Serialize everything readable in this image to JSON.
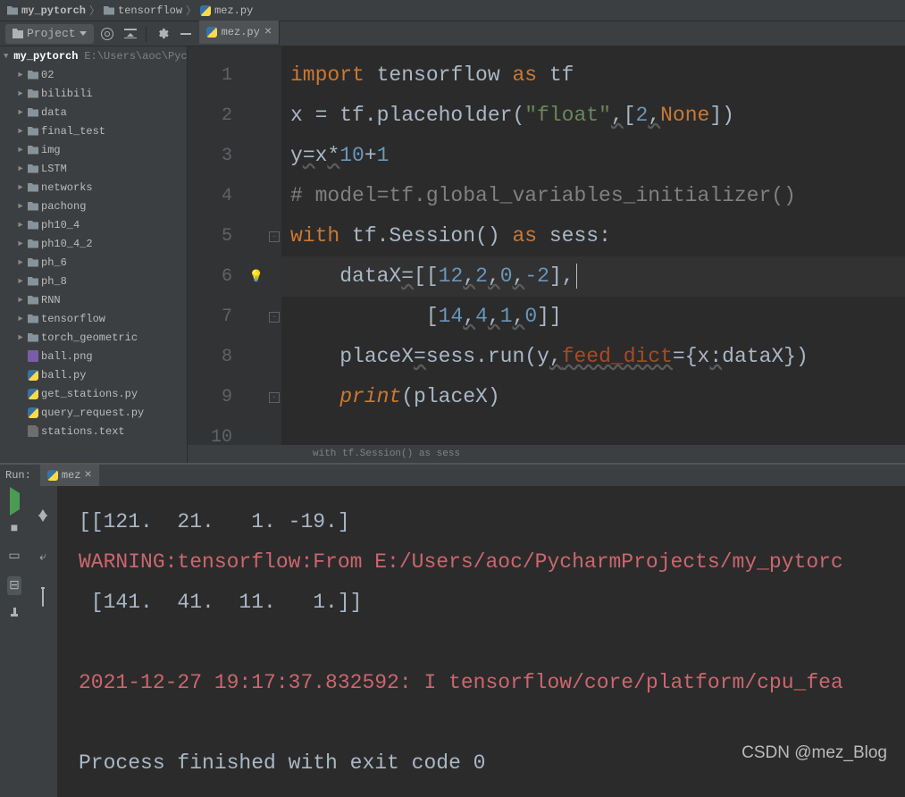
{
  "breadcrumb": [
    {
      "type": "folder",
      "label": "my_pytorch"
    },
    {
      "type": "folder",
      "label": "tensorflow"
    },
    {
      "type": "py",
      "label": "mez.py"
    }
  ],
  "projectBtn": "Project",
  "editorTab": {
    "label": "mez.py"
  },
  "tree": {
    "root": {
      "label": "my_pytorch",
      "path": "E:\\Users\\aoc\\Pyc"
    },
    "items": [
      {
        "depth": 1,
        "type": "folder",
        "label": "02",
        "chev": "►"
      },
      {
        "depth": 1,
        "type": "folder",
        "label": "bilibili",
        "chev": "►"
      },
      {
        "depth": 1,
        "type": "folder",
        "label": "data",
        "chev": "►"
      },
      {
        "depth": 1,
        "type": "folder",
        "label": "final_test",
        "chev": "►"
      },
      {
        "depth": 1,
        "type": "folder",
        "label": "img",
        "chev": "►"
      },
      {
        "depth": 1,
        "type": "folder",
        "label": "LSTM",
        "chev": "►"
      },
      {
        "depth": 1,
        "type": "folder",
        "label": "networks",
        "chev": "►"
      },
      {
        "depth": 1,
        "type": "folder",
        "label": "pachong",
        "chev": "►"
      },
      {
        "depth": 1,
        "type": "folder",
        "label": "ph10_4",
        "chev": "►"
      },
      {
        "depth": 1,
        "type": "folder",
        "label": "ph10_4_2",
        "chev": "►"
      },
      {
        "depth": 1,
        "type": "folder",
        "label": "ph_6",
        "chev": "►"
      },
      {
        "depth": 1,
        "type": "folder",
        "label": "ph_8",
        "chev": "►"
      },
      {
        "depth": 1,
        "type": "folder",
        "label": "RNN",
        "chev": "►"
      },
      {
        "depth": 1,
        "type": "folder",
        "label": "tensorflow",
        "chev": "►"
      },
      {
        "depth": 1,
        "type": "folder",
        "label": "torch_geometric",
        "chev": "►"
      },
      {
        "depth": 1,
        "type": "png",
        "label": "ball.png",
        "chev": ""
      },
      {
        "depth": 1,
        "type": "py",
        "label": "ball.py",
        "chev": ""
      },
      {
        "depth": 1,
        "type": "py",
        "label": "get_stations.py",
        "chev": ""
      },
      {
        "depth": 1,
        "type": "py",
        "label": "query_request.py",
        "chev": ""
      },
      {
        "depth": 1,
        "type": "txt",
        "label": "stations.text",
        "chev": ""
      }
    ]
  },
  "code": {
    "lines": [
      {
        "n": "1",
        "tokens": [
          {
            "t": "import ",
            "c": "kw"
          },
          {
            "t": "tensorflow ",
            "c": "def"
          },
          {
            "t": "as ",
            "c": "kw"
          },
          {
            "t": "tf",
            "c": "def"
          }
        ]
      },
      {
        "n": "2",
        "tokens": [
          {
            "t": "x = tf.placeholder(",
            "c": "def"
          },
          {
            "t": "\"float\"",
            "c": "str"
          },
          {
            "t": ",",
            "c": "def",
            "wavy": true
          },
          {
            "t": "[",
            "c": "def"
          },
          {
            "t": "2",
            "c": "num"
          },
          {
            "t": ",",
            "c": "def",
            "wavy": true
          },
          {
            "t": "None",
            "c": "kw"
          },
          {
            "t": "])",
            "c": "def"
          }
        ]
      },
      {
        "n": "3",
        "tokens": [
          {
            "t": "y",
            "c": "def"
          },
          {
            "t": "=",
            "c": "def",
            "wavy": true
          },
          {
            "t": "x",
            "c": "def"
          },
          {
            "t": "*",
            "c": "def",
            "wavy": true
          },
          {
            "t": "10",
            "c": "num"
          },
          {
            "t": "+",
            "c": "def"
          },
          {
            "t": "1",
            "c": "num"
          }
        ]
      },
      {
        "n": "4",
        "tokens": [
          {
            "t": "# model=tf.global_variables_initializer()",
            "c": "com"
          }
        ]
      },
      {
        "n": "5",
        "tokens": [
          {
            "t": "with ",
            "c": "kw"
          },
          {
            "t": "tf.Session() ",
            "c": "def"
          },
          {
            "t": "as ",
            "c": "kw"
          },
          {
            "t": "sess:",
            "c": "def"
          }
        ],
        "fold": "-"
      },
      {
        "n": "6",
        "tokens": [
          {
            "t": "    dataX",
            "c": "def"
          },
          {
            "t": "=",
            "c": "def",
            "wavy": true
          },
          {
            "t": "[[",
            "c": "def"
          },
          {
            "t": "12",
            "c": "num"
          },
          {
            "t": ",",
            "c": "def",
            "wavy": true
          },
          {
            "t": "2",
            "c": "num"
          },
          {
            "t": ",",
            "c": "def",
            "wavy": true
          },
          {
            "t": "0",
            "c": "num"
          },
          {
            "t": ",",
            "c": "def",
            "wavy": true
          },
          {
            "t": "-2",
            "c": "num"
          },
          {
            "t": "],",
            "c": "def"
          }
        ],
        "hl": true,
        "bulb": true,
        "caret": true
      },
      {
        "n": "7",
        "tokens": [
          {
            "t": "           [",
            "c": "def"
          },
          {
            "t": "14",
            "c": "num"
          },
          {
            "t": ",",
            "c": "def",
            "wavy": true
          },
          {
            "t": "4",
            "c": "num"
          },
          {
            "t": ",",
            "c": "def",
            "wavy": true
          },
          {
            "t": "1",
            "c": "num"
          },
          {
            "t": ",",
            "c": "def",
            "wavy": true
          },
          {
            "t": "0",
            "c": "num"
          },
          {
            "t": "]]",
            "c": "def"
          }
        ],
        "fold": "-"
      },
      {
        "n": "8",
        "tokens": [
          {
            "t": "    placeX",
            "c": "def"
          },
          {
            "t": "=",
            "c": "def",
            "wavy": true
          },
          {
            "t": "sess.run(y",
            "c": "def"
          },
          {
            "t": ",",
            "c": "def",
            "wavy": true
          },
          {
            "t": "feed_dict",
            "c": "param",
            "wavy": true
          },
          {
            "t": "={x",
            "c": "def"
          },
          {
            "t": ":",
            "c": "def",
            "wavy": true
          },
          {
            "t": "dataX})",
            "c": "def"
          }
        ]
      },
      {
        "n": "9",
        "tokens": [
          {
            "t": "    ",
            "c": "def"
          },
          {
            "t": "print",
            "c": "kw-i"
          },
          {
            "t": "(placeX)",
            "c": "def"
          }
        ],
        "fold": "-"
      },
      {
        "n": "10",
        "tokens": []
      }
    ],
    "footer": "with tf.Session() as sess"
  },
  "run": {
    "title": "Run:",
    "tab": "mez",
    "lines": [
      {
        "c": "out",
        "t": "[[121.  21.   1. -19.]"
      },
      {
        "c": "err",
        "t": "WARNING:tensorflow:From E:/Users/aoc/PycharmProjects/my_pytorc"
      },
      {
        "c": "out",
        "t": " [141.  41.  11.   1.]]"
      },
      {
        "c": "out",
        "t": ""
      },
      {
        "c": "err",
        "t": "2021-12-27 19:17:37.832592: I tensorflow/core/platform/cpu_fea"
      },
      {
        "c": "out",
        "t": ""
      },
      {
        "c": "out",
        "t": "Process finished with exit code 0"
      }
    ]
  },
  "watermark": "CSDN @mez_Blog"
}
